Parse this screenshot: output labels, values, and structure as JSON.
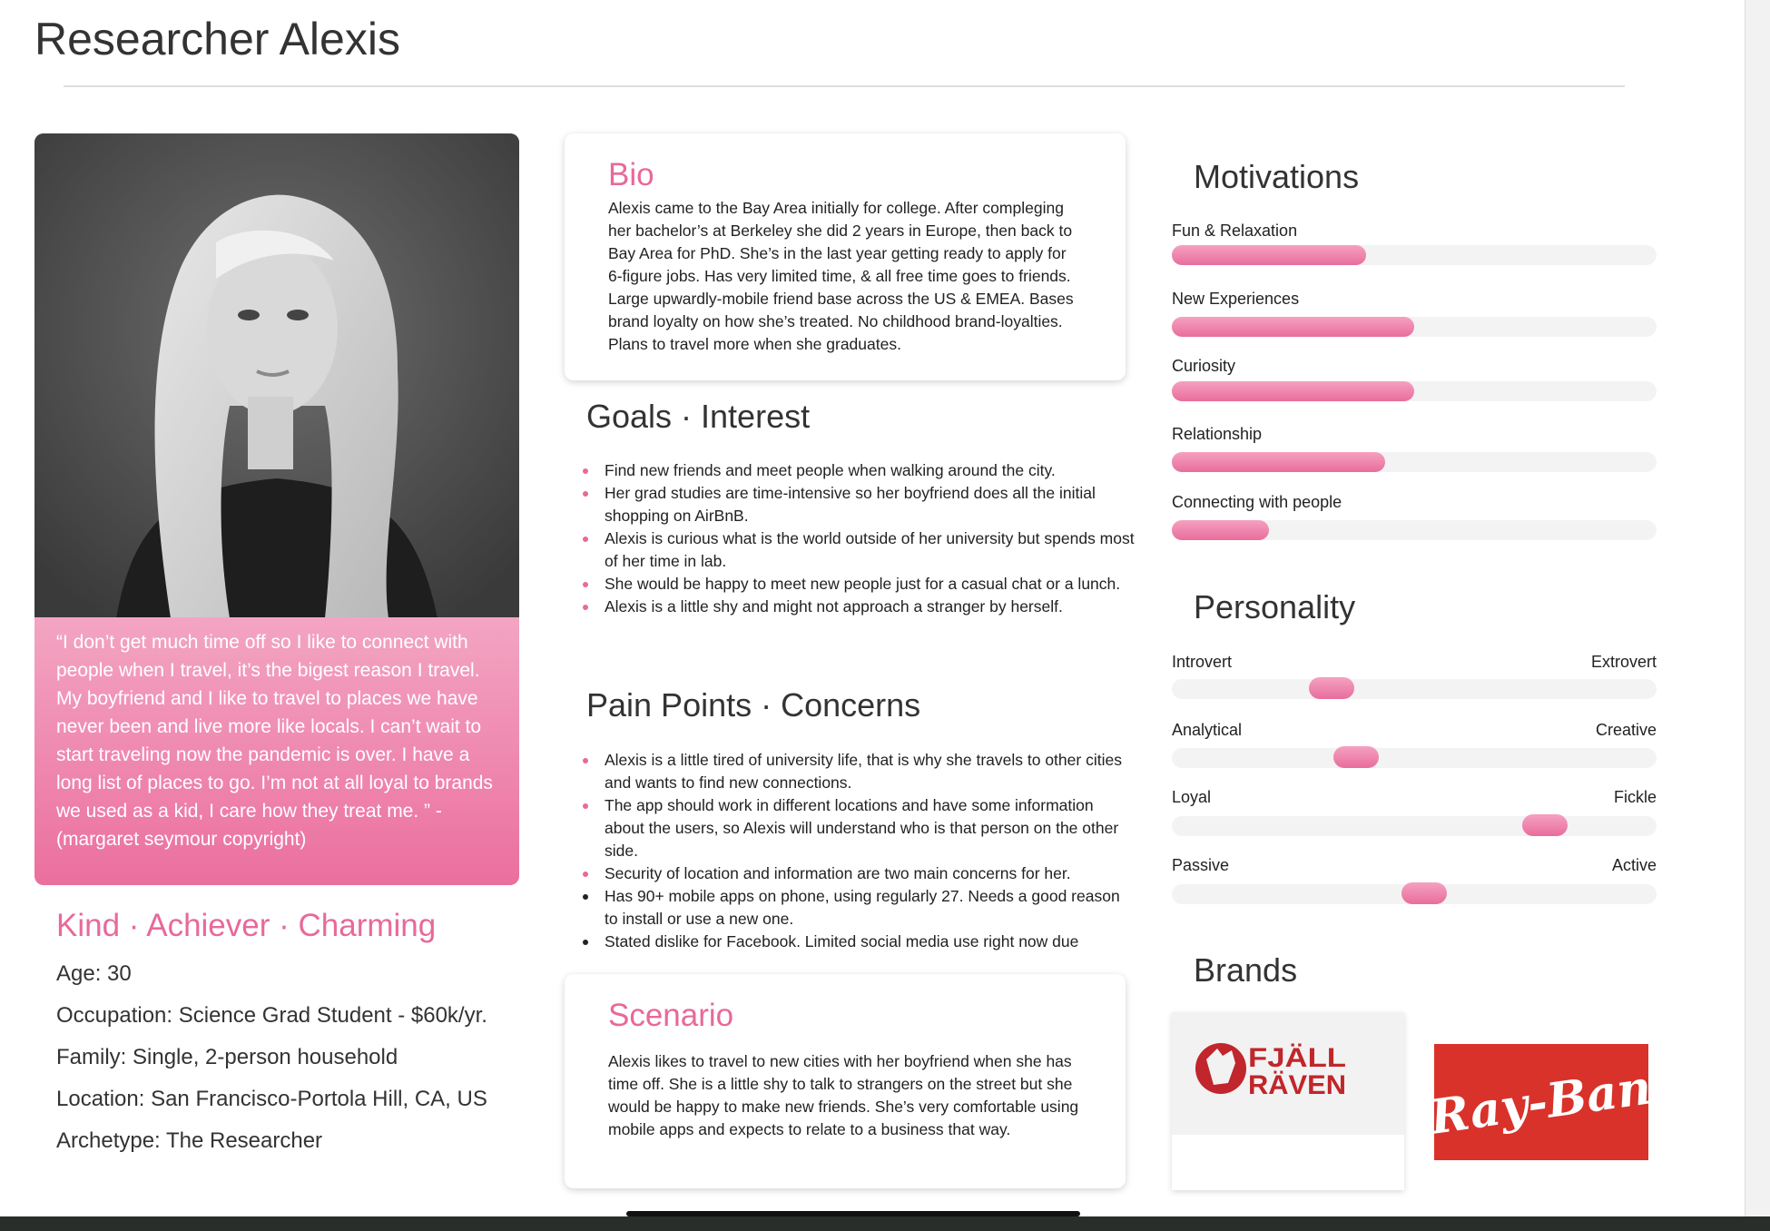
{
  "title": "Researcher Alexis",
  "quote": "“I don’t get much time off so I like to connect with people when I travel, it’s the bigest reason I travel. My boyfriend and I like to travel to places we have never been and live more like locals. I can’t wait to start traveling now the pandemic is over. I have a long list of places to go. I’m not at all loyal to brands we used as a kid, I care how they treat me. ” - (margaret seymour copyright)",
  "traits": "Kind · Achiever · Charming",
  "facts": [
    "Age: 30",
    "Occupation: Science Grad Student - $60k/yr.",
    "Family: Single, 2-person household",
    "Location: San Francisco-Portola Hill, CA, US",
    "Archetype: The Researcher"
  ],
  "bio": {
    "title": "Bio",
    "text": "Alexis came to the Bay Area initially for college. After compleging her bachelor’s at Berkeley she did 2 years in Europe, then back to Bay Area  for PhD.  She’s in the last year getting ready to apply for 6-figure jobs. Has very limited time, & all free time goes to friends. Large upwardly-mobile friend base across the US & EMEA. Bases brand loyalty on how she’s treated.  No childhood brand-loyalties. Plans to travel more when she graduates."
  },
  "goals": {
    "title": "Goals · Interest",
    "items": [
      "Find new friends and meet people when walking around the city.",
      "Her grad studies are time-intensive so her boyfriend does all the initial shopping on AirBnB.",
      "Alexis is curious what is the world outside of her university but spends most of her time in lab.",
      "She would be happy to meet new people just for a casual chat or a lunch.",
      "Alexis is a little shy and might not approach a stranger by herself."
    ]
  },
  "pain": {
    "title": "Pain Points · Concerns",
    "items": [
      "Alexis is a little tired of university life, that is why she travels to other cities and wants to find new connections.",
      "The app should work in different locations and have some information about the users, so Alexis will understand who is that person on the other side.",
      "Security of location and information are two main concerns for her.",
      "Has 90+ mobile apps on phone, using regularly 27. Needs a good reason to install or use a new one.",
      "Stated dislike for Facebook. Limited social media use right now due"
    ]
  },
  "scenario": {
    "title": "Scenario",
    "text": "Alexis likes to travel to new cities with her boyfriend when she has time off. She is a little shy to talk to strangers on the street but she would be happy to make new friends. She’s very comfortable using mobile apps and expects to relate to a business that way."
  },
  "motivations": {
    "title": "Motivations",
    "items": [
      {
        "label": "Fun & Relaxation",
        "value": 0.4
      },
      {
        "label": "New Experiences",
        "value": 0.5
      },
      {
        "label": "Curiosity",
        "value": 0.5
      },
      {
        "label": "Relationship",
        "value": 0.44
      },
      {
        "label": "Connecting with people",
        "value": 0.2
      }
    ]
  },
  "personality": {
    "title": "Personality",
    "items": [
      {
        "left": "Introvert",
        "right": "Extrovert",
        "value": 0.33
      },
      {
        "left": "Analytical",
        "right": "Creative",
        "value": 0.38
      },
      {
        "left": "Loyal",
        "right": "Fickle",
        "value": 0.77
      },
      {
        "left": "Passive",
        "right": "Active",
        "value": 0.52
      }
    ]
  },
  "brands": {
    "title": "Brands",
    "items": [
      "FJÄLL RÄVEN",
      "Ray-Ban"
    ]
  },
  "colors": {
    "accent": "#e8699a",
    "rayban": "#d9322a",
    "fjallraven": "#c0262b"
  }
}
